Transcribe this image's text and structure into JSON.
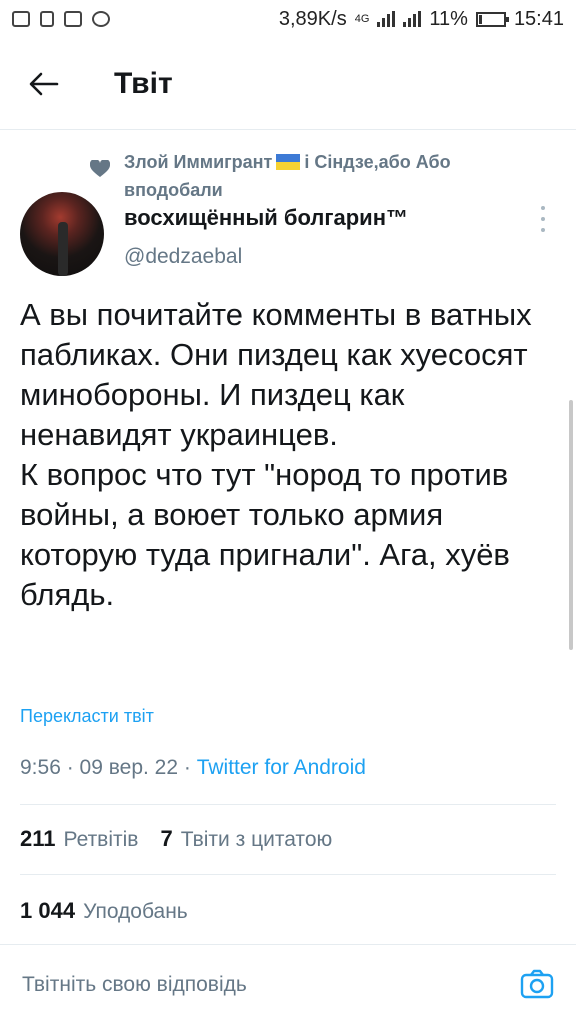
{
  "status_bar": {
    "network_speed": "3,89K/s",
    "network_type": "4G",
    "battery": "11%",
    "battery_level": 0.11,
    "time": "15:41"
  },
  "header": {
    "back_icon": "arrow-left-icon",
    "title": "Твіт"
  },
  "social_context": {
    "icon": "heart-icon",
    "text_before_flag": "Злой Иммигрант",
    "text_after_flag": "і Сіндзе,або Або вподобали",
    "flag_colors": [
      "#3d7ad5",
      "#f6d233"
    ]
  },
  "author": {
    "name": "восхищённый болгарин™",
    "handle": "@dedzaebal"
  },
  "tweet": {
    "text": "А вы почитайте комменты в ватных пабликах. Они пиздец как хуесосят минобороны. И пиздец как ненавидят украинцев.\nК вопрос что тут \"нород то против войны, а воюет только армия которую туда пригнали\". Ага, хуёв блядь.",
    "translate_label": "Перекласти твіт",
    "timestamp": "9:56 · 09 вер. 22 · ",
    "source": "Twitter for Android"
  },
  "stats": {
    "retweets_count": "211",
    "retweets_label": "Ретвітів",
    "quotes_count": "7",
    "quotes_label": "Твіти з цитатою",
    "likes_count": "1 044",
    "likes_label": "Уподобань"
  },
  "reply": {
    "placeholder": "Твітніть свою відповідь",
    "camera_icon": "camera-icon"
  },
  "colors": {
    "accent": "#1da1f2",
    "secondary_text": "#657786",
    "primary_text": "#14171a"
  }
}
